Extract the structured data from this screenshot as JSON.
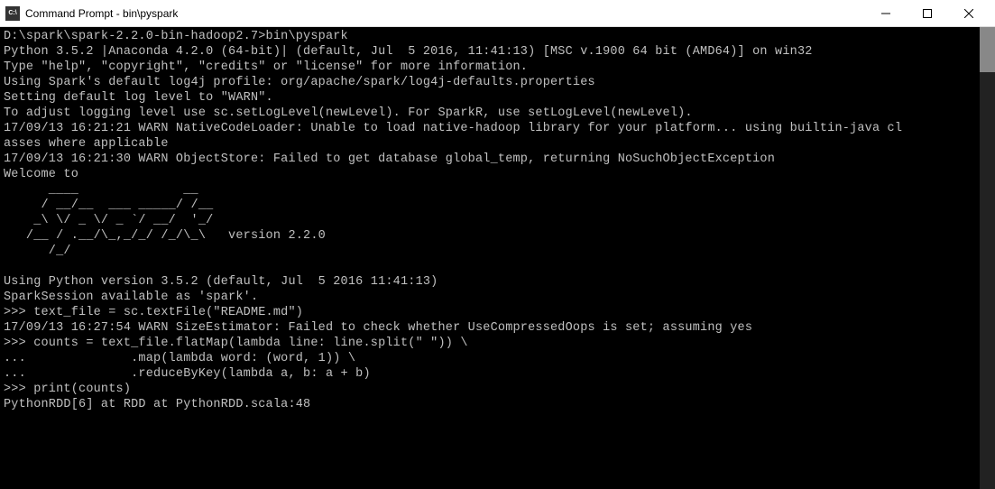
{
  "window": {
    "title": "Command Prompt - bin\\pyspark"
  },
  "terminal": {
    "lines": [
      "D:\\spark\\spark-2.2.0-bin-hadoop2.7>bin\\pyspark",
      "Python 3.5.2 |Anaconda 4.2.0 (64-bit)| (default, Jul  5 2016, 11:41:13) [MSC v.1900 64 bit (AMD64)] on win32",
      "Type \"help\", \"copyright\", \"credits\" or \"license\" for more information.",
      "Using Spark's default log4j profile: org/apache/spark/log4j-defaults.properties",
      "Setting default log level to \"WARN\".",
      "To adjust logging level use sc.setLogLevel(newLevel). For SparkR, use setLogLevel(newLevel).",
      "17/09/13 16:21:21 WARN NativeCodeLoader: Unable to load native-hadoop library for your platform... using builtin-java cl",
      "asses where applicable",
      "17/09/13 16:21:30 WARN ObjectStore: Failed to get database global_temp, returning NoSuchObjectException",
      "Welcome to",
      "      ____              __",
      "     / __/__  ___ _____/ /__",
      "    _\\ \\/ _ \\/ _ `/ __/  '_/",
      "   /__ / .__/\\_,_/_/ /_/\\_\\   version 2.2.0",
      "      /_/",
      "",
      "Using Python version 3.5.2 (default, Jul  5 2016 11:41:13)",
      "SparkSession available as 'spark'.",
      ">>> text_file = sc.textFile(\"README.md\")",
      "17/09/13 16:27:54 WARN SizeEstimator: Failed to check whether UseCompressedOops is set; assuming yes",
      ">>> counts = text_file.flatMap(lambda line: line.split(\" \")) \\",
      "...              .map(lambda word: (word, 1)) \\",
      "...              .reduceByKey(lambda a, b: a + b)",
      ">>> print(counts)",
      "PythonRDD[6] at RDD at PythonRDD.scala:48"
    ]
  }
}
